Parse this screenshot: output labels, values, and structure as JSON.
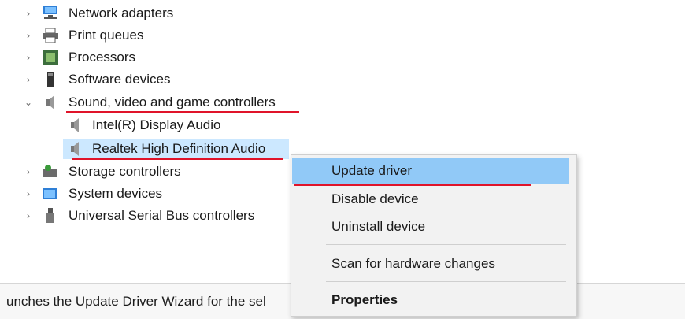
{
  "tree": {
    "items": [
      {
        "label": "Network adapters",
        "icon": "network-adapter-icon",
        "expanded": false
      },
      {
        "label": "Print queues",
        "icon": "printer-icon",
        "expanded": false
      },
      {
        "label": "Processors",
        "icon": "processor-icon",
        "expanded": false
      },
      {
        "label": "Software devices",
        "icon": "software-device-icon",
        "expanded": false
      },
      {
        "label": "Sound, video and game controllers",
        "icon": "speaker-icon",
        "expanded": true
      },
      {
        "label": "Intel(R) Display Audio",
        "icon": "speaker-icon",
        "child": true
      },
      {
        "label": "Realtek High Definition Audio",
        "icon": "speaker-icon",
        "child": true,
        "selected": true
      },
      {
        "label": "Storage controllers",
        "icon": "storage-icon",
        "expanded": false
      },
      {
        "label": "System devices",
        "icon": "system-device-icon",
        "expanded": false
      },
      {
        "label": "Universal Serial Bus controllers",
        "icon": "usb-icon",
        "expanded": false
      }
    ]
  },
  "context_menu": {
    "items": [
      {
        "label": "Update driver",
        "highlighted": true
      },
      {
        "label": "Disable device"
      },
      {
        "label": "Uninstall device"
      },
      {
        "label": "Scan for hardware changes"
      },
      {
        "label": "Properties",
        "bold": true
      }
    ]
  },
  "status_bar": {
    "text": "unches the Update Driver Wizard for the sel"
  },
  "colors": {
    "selection": "#cce8ff",
    "menu_highlight": "#91c9f7",
    "annotation_red": "#e0142a",
    "menu_background": "#f2f2f2"
  }
}
